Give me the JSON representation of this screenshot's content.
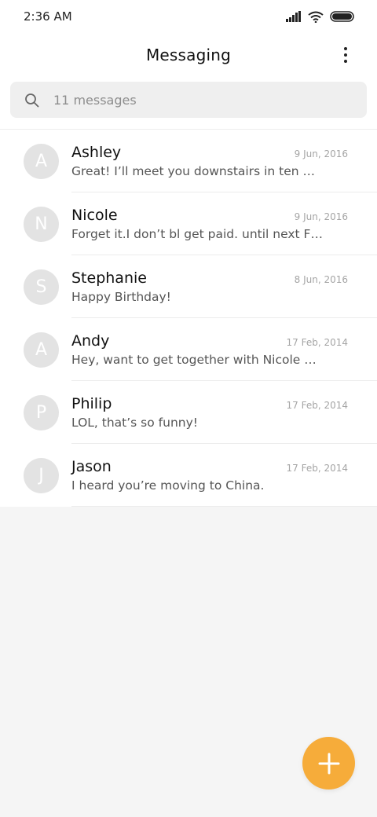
{
  "status_bar": {
    "time": "2:36 AM",
    "icons": [
      "signal-icon",
      "wifi-icon",
      "battery-icon"
    ]
  },
  "header": {
    "title": "Messaging",
    "menu_icon": "more-vert-icon"
  },
  "search": {
    "placeholder": "11 messages",
    "icon": "search-icon"
  },
  "conversations": [
    {
      "initial": "A",
      "name": "Ashley",
      "date": "9 Jun, 2016",
      "preview": "Great! I’ll meet you downstairs in ten …"
    },
    {
      "initial": "N",
      "name": "Nicole",
      "date": "9 Jun, 2016",
      "preview": "Forget it.I don’t bl get paid. until next F…"
    },
    {
      "initial": "S",
      "name": "Stephanie",
      "date": "8 Jun, 2016",
      "preview": "Happy Birthday!"
    },
    {
      "initial": "A",
      "name": "Andy",
      "date": "17 Feb, 2014",
      "preview": "Hey, want to get together with Nicole …"
    },
    {
      "initial": "P",
      "name": "Philip",
      "date": "17 Feb, 2014",
      "preview": "LOL, that’s so funny!"
    },
    {
      "initial": "J",
      "name": "Jason",
      "date": "17 Feb, 2014",
      "preview": "I heard you’re moving to China."
    }
  ],
  "fab": {
    "icon": "plus-icon",
    "color": "#f6ac3a"
  },
  "colors": {
    "accent": "#f6ac3a",
    "avatar_bg": "#e3e3e3",
    "background": "#f5f5f5"
  }
}
